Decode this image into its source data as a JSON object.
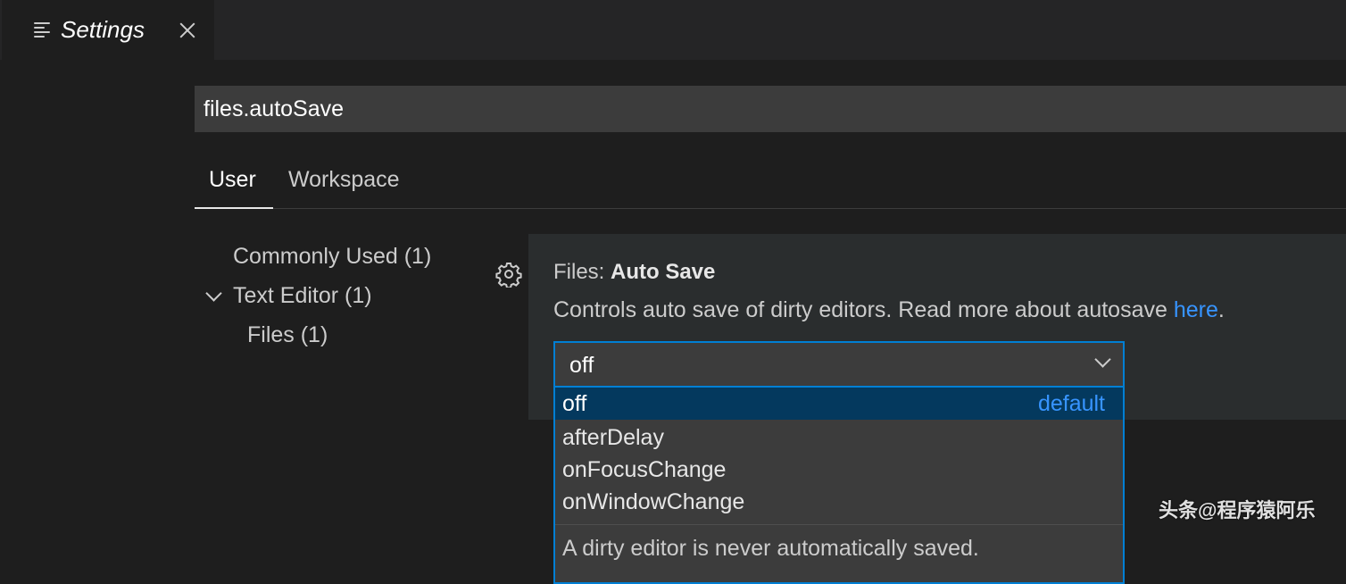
{
  "tab": {
    "icon": "settings-list-icon",
    "title": "Settings",
    "close_icon": "close-icon"
  },
  "search": {
    "value": "files.autoSave"
  },
  "scope_tabs": [
    {
      "label": "User",
      "active": true
    },
    {
      "label": "Workspace",
      "active": false
    }
  ],
  "toc": {
    "items": [
      {
        "label": "Commonly Used (1)"
      },
      {
        "label": "Text Editor (1)",
        "expanded": true
      },
      {
        "label": "Files (1)"
      }
    ]
  },
  "setting": {
    "gear_icon": "gear-icon",
    "category": "Files: ",
    "name": "Auto Save",
    "description": "Controls auto save of dirty editors. Read more about autosave ",
    "link_text": "here",
    "description_end": ".",
    "current_value": "off"
  },
  "dropdown": {
    "options": [
      {
        "label": "off",
        "badge": "default",
        "selected": true
      },
      {
        "label": "afterDelay"
      },
      {
        "label": "onFocusChange"
      },
      {
        "label": "onWindowChange"
      }
    ],
    "description": "A dirty editor is never automatically saved."
  },
  "watermark": "头条@程序猿阿乐",
  "colors": {
    "background": "#1e1e1e",
    "accent": "#007fd4",
    "link": "#3794ff",
    "selected_option": "#04395e"
  }
}
